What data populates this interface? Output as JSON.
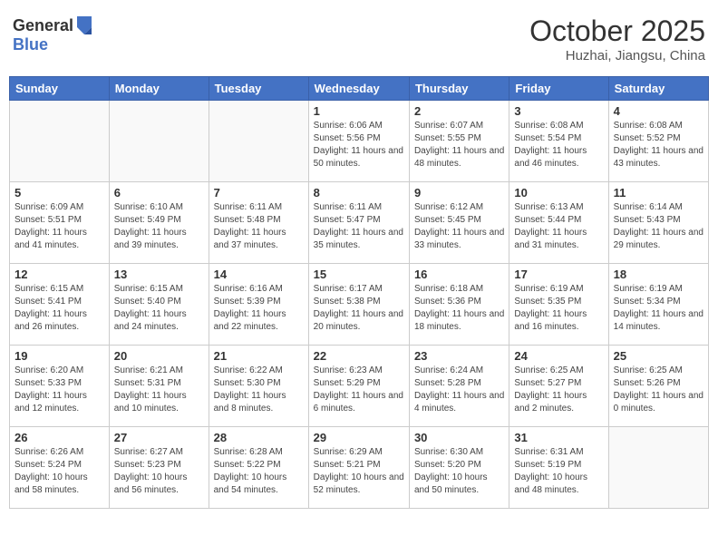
{
  "header": {
    "logo": {
      "general": "General",
      "blue": "Blue"
    },
    "title": "October 2025",
    "location": "Huzhai, Jiangsu, China"
  },
  "days_of_week": [
    "Sunday",
    "Monday",
    "Tuesday",
    "Wednesday",
    "Thursday",
    "Friday",
    "Saturday"
  ],
  "weeks": [
    {
      "days": [
        {
          "number": "",
          "empty": true
        },
        {
          "number": "",
          "empty": true
        },
        {
          "number": "",
          "empty": true
        },
        {
          "number": "1",
          "sunrise": "6:06 AM",
          "sunset": "5:56 PM",
          "daylight": "11 hours and 50 minutes."
        },
        {
          "number": "2",
          "sunrise": "6:07 AM",
          "sunset": "5:55 PM",
          "daylight": "11 hours and 48 minutes."
        },
        {
          "number": "3",
          "sunrise": "6:08 AM",
          "sunset": "5:54 PM",
          "daylight": "11 hours and 46 minutes."
        },
        {
          "number": "4",
          "sunrise": "6:08 AM",
          "sunset": "5:52 PM",
          "daylight": "11 hours and 43 minutes."
        }
      ]
    },
    {
      "days": [
        {
          "number": "5",
          "sunrise": "6:09 AM",
          "sunset": "5:51 PM",
          "daylight": "11 hours and 41 minutes."
        },
        {
          "number": "6",
          "sunrise": "6:10 AM",
          "sunset": "5:49 PM",
          "daylight": "11 hours and 39 minutes."
        },
        {
          "number": "7",
          "sunrise": "6:11 AM",
          "sunset": "5:48 PM",
          "daylight": "11 hours and 37 minutes."
        },
        {
          "number": "8",
          "sunrise": "6:11 AM",
          "sunset": "5:47 PM",
          "daylight": "11 hours and 35 minutes."
        },
        {
          "number": "9",
          "sunrise": "6:12 AM",
          "sunset": "5:45 PM",
          "daylight": "11 hours and 33 minutes."
        },
        {
          "number": "10",
          "sunrise": "6:13 AM",
          "sunset": "5:44 PM",
          "daylight": "11 hours and 31 minutes."
        },
        {
          "number": "11",
          "sunrise": "6:14 AM",
          "sunset": "5:43 PM",
          "daylight": "11 hours and 29 minutes."
        }
      ]
    },
    {
      "days": [
        {
          "number": "12",
          "sunrise": "6:15 AM",
          "sunset": "5:41 PM",
          "daylight": "11 hours and 26 minutes."
        },
        {
          "number": "13",
          "sunrise": "6:15 AM",
          "sunset": "5:40 PM",
          "daylight": "11 hours and 24 minutes."
        },
        {
          "number": "14",
          "sunrise": "6:16 AM",
          "sunset": "5:39 PM",
          "daylight": "11 hours and 22 minutes."
        },
        {
          "number": "15",
          "sunrise": "6:17 AM",
          "sunset": "5:38 PM",
          "daylight": "11 hours and 20 minutes."
        },
        {
          "number": "16",
          "sunrise": "6:18 AM",
          "sunset": "5:36 PM",
          "daylight": "11 hours and 18 minutes."
        },
        {
          "number": "17",
          "sunrise": "6:19 AM",
          "sunset": "5:35 PM",
          "daylight": "11 hours and 16 minutes."
        },
        {
          "number": "18",
          "sunrise": "6:19 AM",
          "sunset": "5:34 PM",
          "daylight": "11 hours and 14 minutes."
        }
      ]
    },
    {
      "days": [
        {
          "number": "19",
          "sunrise": "6:20 AM",
          "sunset": "5:33 PM",
          "daylight": "11 hours and 12 minutes."
        },
        {
          "number": "20",
          "sunrise": "6:21 AM",
          "sunset": "5:31 PM",
          "daylight": "11 hours and 10 minutes."
        },
        {
          "number": "21",
          "sunrise": "6:22 AM",
          "sunset": "5:30 PM",
          "daylight": "11 hours and 8 minutes."
        },
        {
          "number": "22",
          "sunrise": "6:23 AM",
          "sunset": "5:29 PM",
          "daylight": "11 hours and 6 minutes."
        },
        {
          "number": "23",
          "sunrise": "6:24 AM",
          "sunset": "5:28 PM",
          "daylight": "11 hours and 4 minutes."
        },
        {
          "number": "24",
          "sunrise": "6:25 AM",
          "sunset": "5:27 PM",
          "daylight": "11 hours and 2 minutes."
        },
        {
          "number": "25",
          "sunrise": "6:25 AM",
          "sunset": "5:26 PM",
          "daylight": "11 hours and 0 minutes."
        }
      ]
    },
    {
      "days": [
        {
          "number": "26",
          "sunrise": "6:26 AM",
          "sunset": "5:24 PM",
          "daylight": "10 hours and 58 minutes."
        },
        {
          "number": "27",
          "sunrise": "6:27 AM",
          "sunset": "5:23 PM",
          "daylight": "10 hours and 56 minutes."
        },
        {
          "number": "28",
          "sunrise": "6:28 AM",
          "sunset": "5:22 PM",
          "daylight": "10 hours and 54 minutes."
        },
        {
          "number": "29",
          "sunrise": "6:29 AM",
          "sunset": "5:21 PM",
          "daylight": "10 hours and 52 minutes."
        },
        {
          "number": "30",
          "sunrise": "6:30 AM",
          "sunset": "5:20 PM",
          "daylight": "10 hours and 50 minutes."
        },
        {
          "number": "31",
          "sunrise": "6:31 AM",
          "sunset": "5:19 PM",
          "daylight": "10 hours and 48 minutes."
        },
        {
          "number": "",
          "empty": true
        }
      ]
    }
  ]
}
